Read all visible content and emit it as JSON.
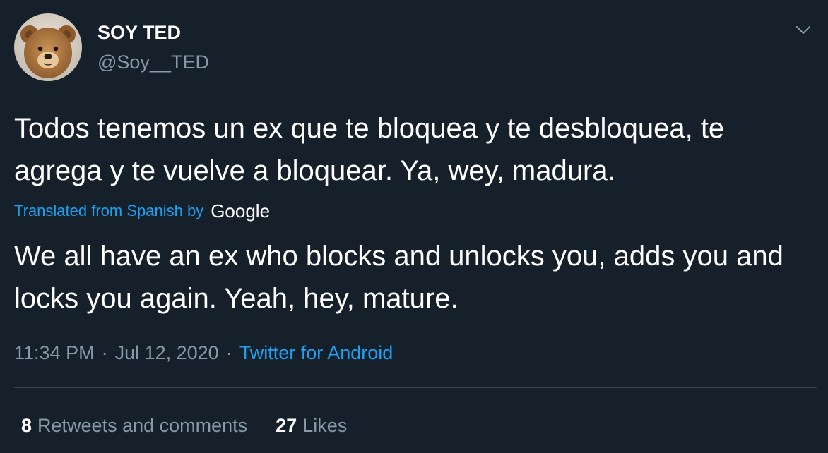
{
  "author": {
    "display_name": "SOY TED",
    "handle": "@Soy__TED"
  },
  "tweet": {
    "original_text": "Todos tenemos un ex que te bloquea y te desbloquea, te agrega y te vuelve a bloquear. Ya, wey, madura.",
    "translation_label": "Translated from Spanish by",
    "translation_provider": "Google",
    "translated_text": "We all have an ex who blocks and unlocks you, adds you and locks you again. Yeah, hey, mature."
  },
  "meta": {
    "time": "11:34 PM",
    "separator": "·",
    "date": "Jul 12, 2020",
    "source": "Twitter for Android"
  },
  "stats": {
    "retweets_count": "8",
    "retweets_label": "Retweets and comments",
    "likes_count": "27",
    "likes_label": "Likes"
  },
  "icons": {
    "menu": "chevron-down-icon",
    "avatar": "teddy-bear-avatar"
  },
  "colors": {
    "background": "#15202b",
    "primary_text": "#ffffff",
    "secondary_text": "#8899a6",
    "link": "#1da1f2",
    "divider": "#38444d"
  }
}
